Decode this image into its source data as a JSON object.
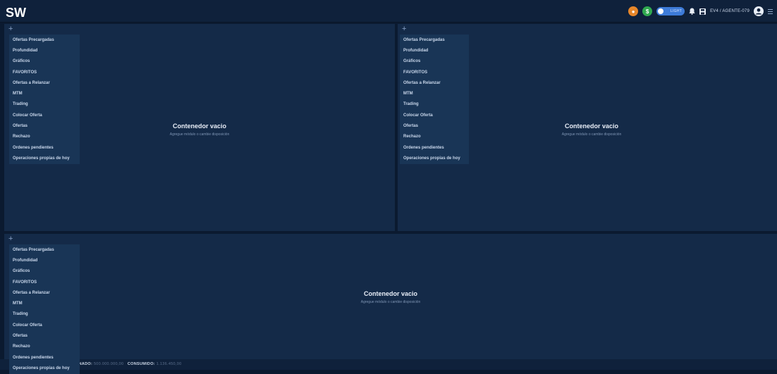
{
  "header": {
    "logo_text": "SW",
    "theme_toggle_label": "LIGHT",
    "agent_label": "EV4 / AGENTE-079",
    "colors": {
      "coin_orange": "#e6862a",
      "coin_green": "#2fa84f",
      "toggle": "#3d7bd8"
    },
    "icons": [
      "coin-icon",
      "dollar-icon",
      "bell-icon",
      "save-icon",
      "user-icon",
      "menu-icon"
    ]
  },
  "modules_menu": {
    "add_symbol": "+",
    "items": [
      "Ofertas Precargadas",
      "Profundidad",
      "Gráficos",
      "FAVORITOS",
      "Ofertas a Relanzar",
      "MTM",
      "Trading",
      "Colocar Oferta",
      "Ofertas",
      "Rechazo",
      "Ordenes pendientes",
      "Operaciones propias de hoy"
    ]
  },
  "empty_container": {
    "title": "Contenedor vacio",
    "subtitle": "Agregue módulo o cambie disposición"
  },
  "footer": {
    "assigned_label": "GNADO:",
    "assigned_value": "500.000.000,00",
    "consumed_label": "CONSUMIDO:",
    "consumed_value": "1.136.450,00"
  }
}
